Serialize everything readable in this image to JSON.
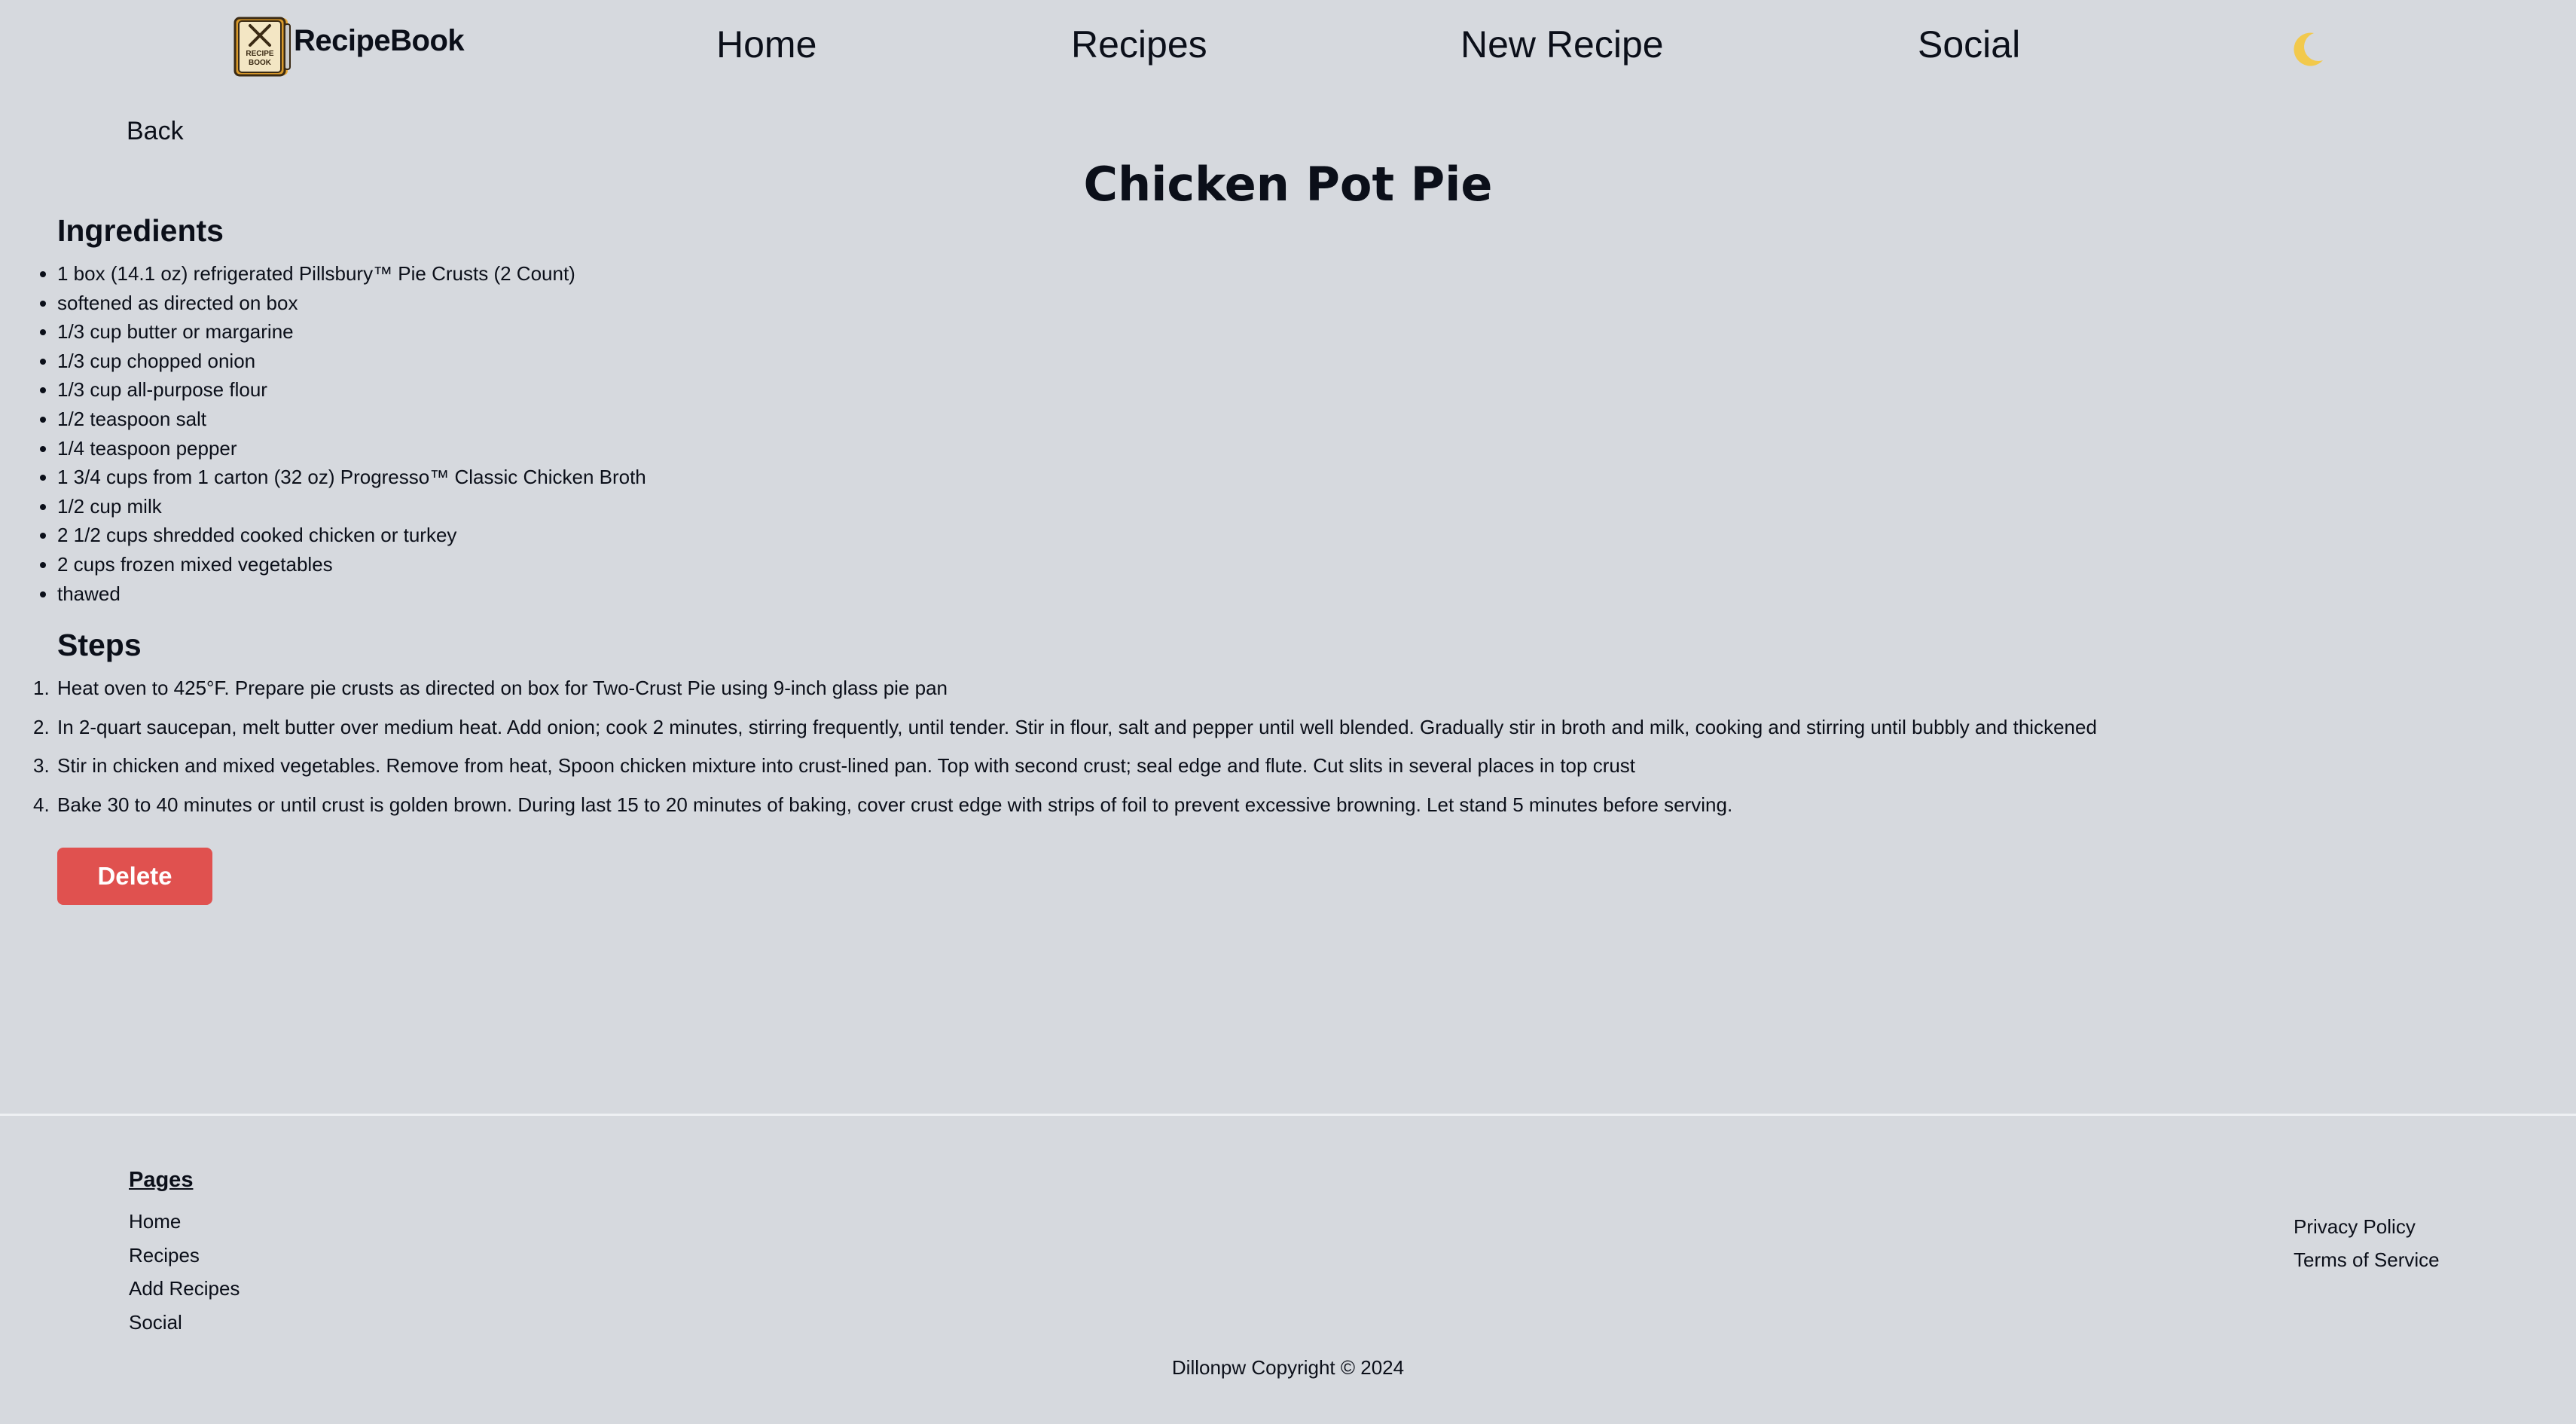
{
  "header": {
    "brand": "RecipeBook",
    "logo_text": [
      "RECIPE",
      "BOOK"
    ],
    "nav": [
      {
        "label": "Home"
      },
      {
        "label": "Recipes"
      },
      {
        "label": "New Recipe"
      },
      {
        "label": "Social"
      }
    ],
    "theme_icon": "moon-icon",
    "accent_color": "#f2c94c"
  },
  "page": {
    "back_label": "Back",
    "title": "Chicken Pot Pie",
    "ingredients_heading": "Ingredients",
    "ingredients": [
      "1 box (14.1 oz) refrigerated Pillsbury™ Pie Crusts (2 Count)",
      "softened as directed on box",
      "1/3 cup butter or margarine",
      "1/3 cup chopped onion",
      "1/3 cup all-purpose flour",
      "1/2 teaspoon salt",
      "1/4 teaspoon pepper",
      "1 3/4 cups from 1 carton (32 oz) Progresso™ Classic Chicken Broth",
      "1/2 cup milk",
      "2 1/2 cups shredded cooked chicken or turkey",
      "2 cups frozen mixed vegetables",
      "thawed"
    ],
    "steps_heading": "Steps",
    "steps": [
      "Heat oven to 425°F. Prepare pie crusts as directed on box for Two-Crust Pie using 9-inch glass pie pan",
      "In 2-quart saucepan, melt butter over medium heat. Add onion; cook 2 minutes, stirring frequently, until tender. Stir in flour, salt and pepper until well blended. Gradually stir in broth and milk, cooking and stirring until bubbly and thickened",
      "Stir in chicken and mixed vegetables. Remove from heat, Spoon chicken mixture into crust-lined pan. Top with second crust; seal edge and flute. Cut slits in several places in top crust",
      "Bake 30 to 40 minutes or until crust is golden brown. During last 15 to 20 minutes of baking, cover crust edge with strips of foil to prevent excessive browning. Let stand 5 minutes before serving."
    ],
    "delete_label": "Delete",
    "delete_color": "#e0514f"
  },
  "footer": {
    "pages_heading": "Pages",
    "links": [
      "Home",
      "Recipes",
      "Add Recipes",
      "Social"
    ],
    "legal": [
      "Privacy Policy",
      "Terms of Service"
    ],
    "copyright": "Dillonpw Copyright © 2024"
  }
}
